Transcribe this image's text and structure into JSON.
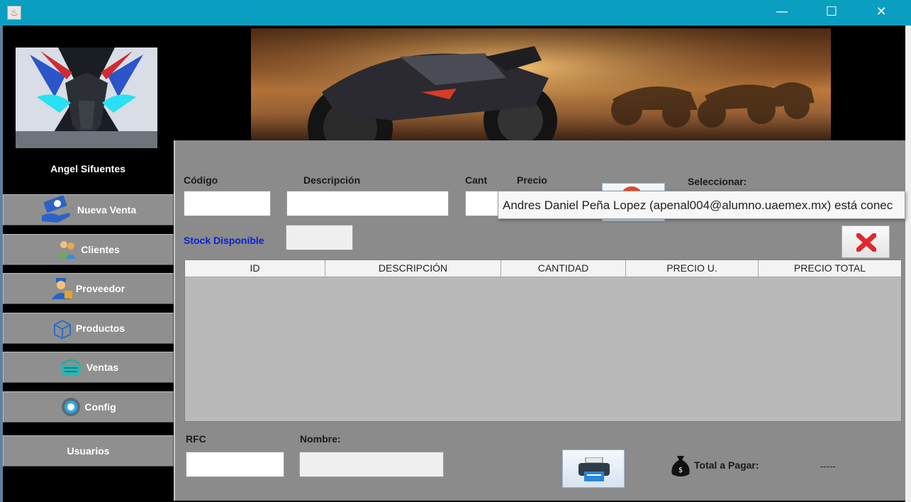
{
  "window": {
    "minimize_glyph": "—",
    "maximize_glyph": "☐",
    "close_glyph": "✕"
  },
  "sidebar": {
    "user_name": "Angel Sifuentes",
    "items": [
      {
        "label": "Nueva Venta",
        "icon": "money-hand-icon"
      },
      {
        "label": "Clientes",
        "icon": "clients-icon"
      },
      {
        "label": "Proveedor",
        "icon": "supplier-icon"
      },
      {
        "label": "Productos",
        "icon": "box-icon"
      },
      {
        "label": "Ventas",
        "icon": "basket-icon"
      },
      {
        "label": "Config",
        "icon": "gear-icon"
      },
      {
        "label": "Usuarios",
        "icon": ""
      }
    ]
  },
  "form": {
    "codigo_label": "Código",
    "descripcion_label": "Descripción",
    "cant_label": "Cant",
    "precio_label": "Precio",
    "seleccionar_label": "Seleccionar:",
    "stock_label": "Stock Disponible"
  },
  "tooltip": {
    "text": "Andres Daniel Peña Lopez (apenal004@alumno.uaemex.mx) está conec"
  },
  "table": {
    "columns": [
      "ID",
      "DESCRIPCIÓN",
      "CANTIDAD",
      "PRECIO U.",
      "PRECIO TOTAL"
    ]
  },
  "footer": {
    "rfc_label": "RFC",
    "nombre_label": "Nombre:",
    "total_label": "Total a Pagar:",
    "total_value": "-----"
  },
  "colors": {
    "titlebar": "#0a9ec0",
    "panel": "#8b8b8b",
    "stock_label": "#0b20d8",
    "delete_red": "#e0282e"
  }
}
